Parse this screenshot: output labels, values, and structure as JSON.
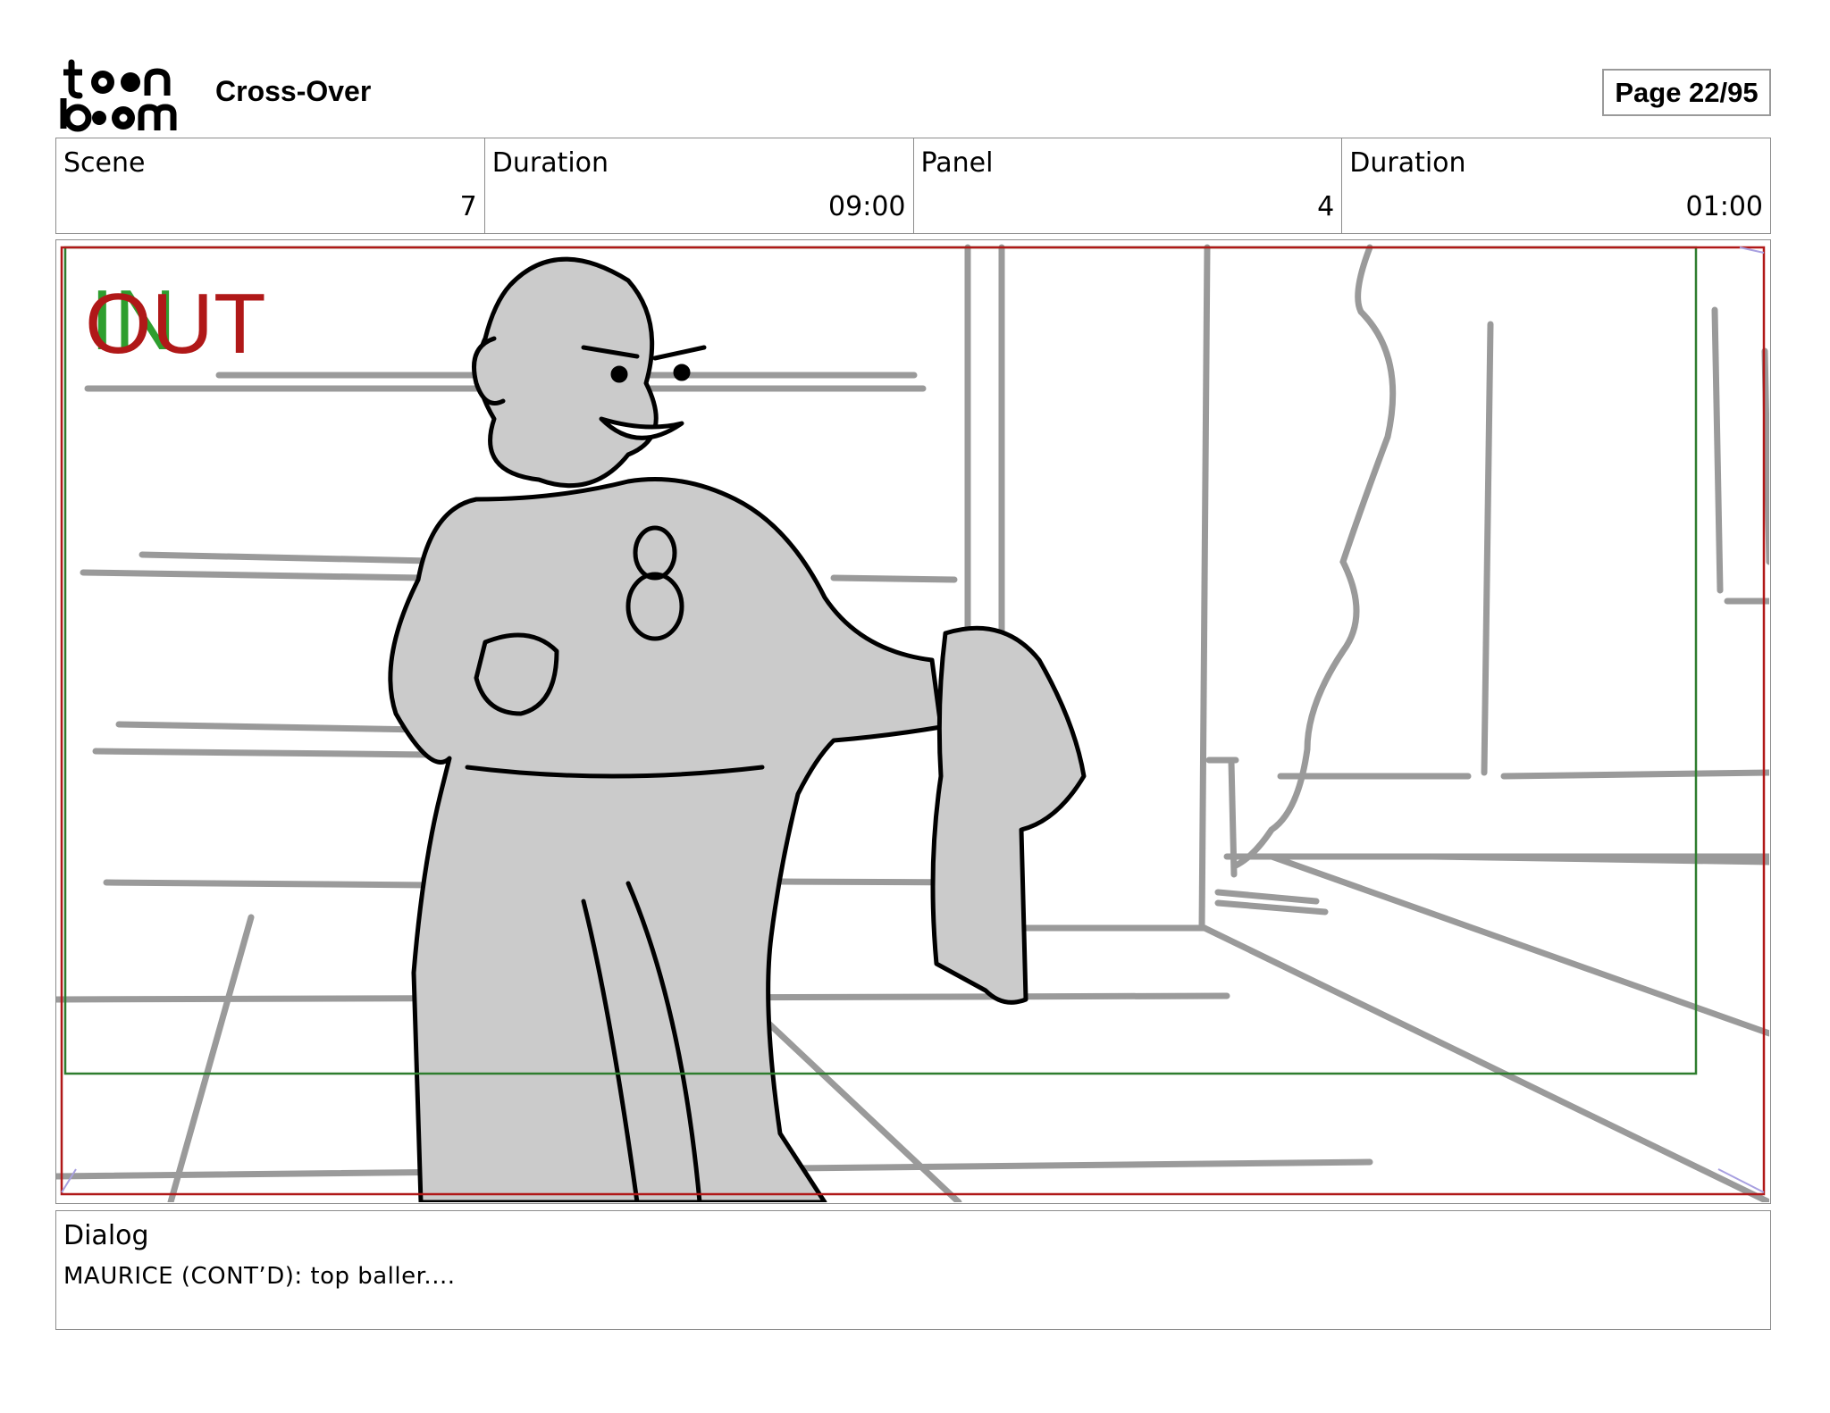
{
  "header": {
    "logo_text": "toon boom",
    "project_title": "Cross-Over",
    "page_label": "Page 22/95"
  },
  "info": {
    "scene_label": "Scene",
    "scene_value": "7",
    "scene_duration_label": "Duration",
    "scene_duration_value": "09:00",
    "panel_label": "Panel",
    "panel_value": "4",
    "panel_duration_label": "Duration",
    "panel_duration_value": "01:00"
  },
  "frame": {
    "in_label": "IN",
    "out_label": "OUT",
    "colors": {
      "in": "#2e9e2e",
      "out": "#b01818",
      "safe_area": "#2e7d2e",
      "frame_border": "#b01818"
    }
  },
  "dialog": {
    "label": "Dialog",
    "text": "MAURICE (CONT’D):  top baller...."
  }
}
